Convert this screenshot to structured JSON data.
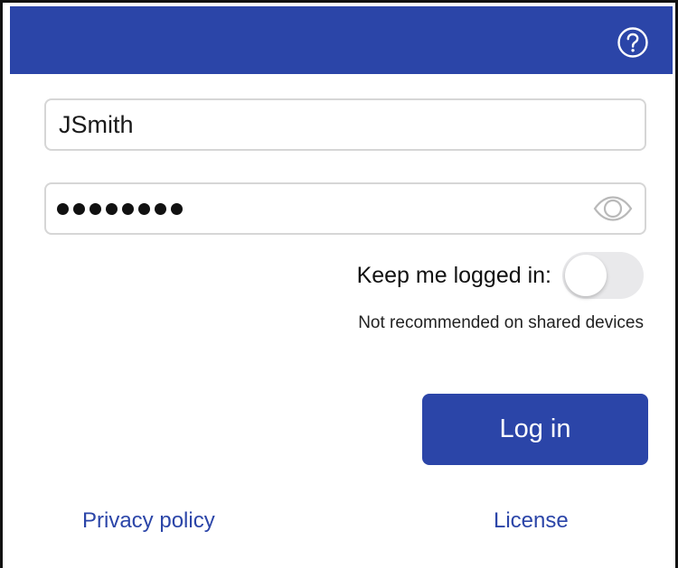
{
  "colors": {
    "brand": "#2b45a8",
    "field_border": "#d6d6d6",
    "toggle_off": "#e9e9eb"
  },
  "header": {
    "help_icon": "question-circle-icon"
  },
  "login_form": {
    "username_value": "JSmith",
    "password_mask": "••••••••",
    "password_length": 8,
    "show_password_icon": "eye-icon",
    "keep_logged_in_label": "Keep me logged in:",
    "keep_logged_in": false,
    "hint": "Not recommended on shared devices",
    "submit_label": "Log in"
  },
  "footer": {
    "privacy_label": "Privacy policy",
    "license_label": "License"
  }
}
